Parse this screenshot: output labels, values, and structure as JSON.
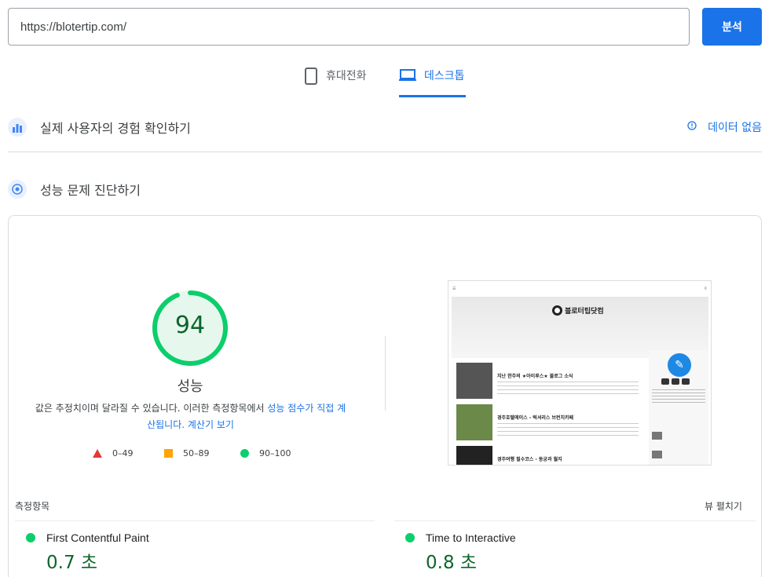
{
  "search": {
    "url": "https://blotertip.com/",
    "analyze_label": "분석"
  },
  "tabs": [
    {
      "label": "휴대전화",
      "icon": "smartphone-icon",
      "active": false
    },
    {
      "label": "데스크톱",
      "icon": "laptop-icon",
      "active": true
    }
  ],
  "field_data": {
    "title": "실제 사용자의 경험 확인하기",
    "no_data_label": "데이터 없음",
    "icon": "field-data-icon"
  },
  "lab": {
    "title": "성능 문제 진단하기",
    "icon": "diagnose-icon"
  },
  "score": {
    "value": "94",
    "fraction": 0.94,
    "label": "성능",
    "note_text": "값은 추정치이며 달라질 수 있습니다. 이러한 측정항목에서 ",
    "note_link": "성능 점수가 직접 계산됩니다.",
    "calculator_link": "계산기 보기",
    "color": "#0cce6b"
  },
  "legend": [
    {
      "range": "0–49",
      "shape": "triangle",
      "color": "#e53935"
    },
    {
      "range": "50–89",
      "shape": "square",
      "color": "#ffa400"
    },
    {
      "range": "90–100",
      "shape": "circle",
      "color": "#0cce6b"
    }
  ],
  "preview": {
    "logo_text": "블로터팁닷컴",
    "posts": [
      {
        "title": "지난 한주의 ★아이루스★ 블로그 소식"
      },
      {
        "title": "경주호텔에이스 - 럭셔리스 브런치카페"
      },
      {
        "title": "경주여행 필수코스 - 동궁과 월지"
      }
    ]
  },
  "metrics": {
    "header": "측정항목",
    "expand_label": "뷰 펼치기",
    "items": [
      {
        "name": "First Contentful Paint",
        "value": "0.7 초",
        "status": "good"
      },
      {
        "name": "Time to Interactive",
        "value": "0.8 초",
        "status": "good"
      }
    ]
  },
  "colors": {
    "accent": "#1a73e8",
    "good": "#0cce6b",
    "good_text": "#0d652d"
  }
}
